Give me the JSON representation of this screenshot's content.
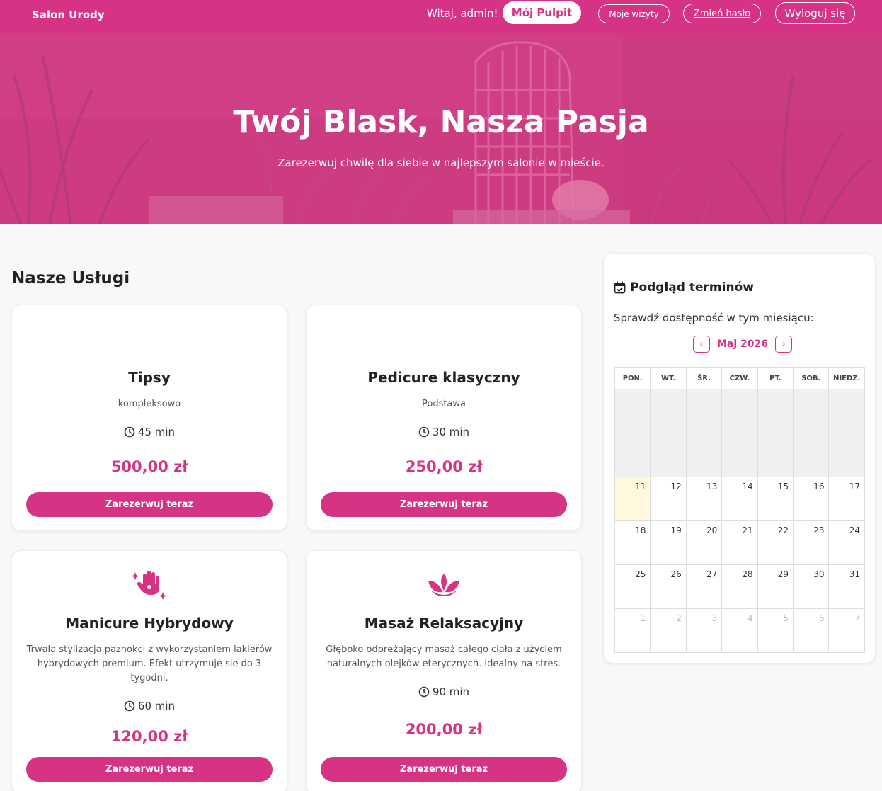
{
  "navbar": {
    "brand": "Salon Urody",
    "welcome": "Witaj, admin!",
    "dashboard": "Mój Pulpit",
    "my_visits": "Moje wizyty",
    "change_password": "Zmień hasło",
    "logout": "Wyloguj się"
  },
  "hero": {
    "title": "Twój Blask, Nasza Pasja",
    "subtitle": "Zarezerwuj chwilę dla siebie w najlepszym salonie w mieście."
  },
  "services": {
    "title": "Nasze Usługi",
    "book_label": "Zarezerwuj teraz",
    "items": [
      {
        "name": "Tipsy",
        "description": "kompleksowo",
        "duration": "45 min",
        "price": "500,00 zł",
        "icon": "none"
      },
      {
        "name": "Pedicure klasyczny",
        "description": "Podstawa",
        "duration": "30 min",
        "price": "250,00 zł",
        "icon": "none"
      },
      {
        "name": "Manicure Hybrydowy",
        "description": "Trwała stylizacja paznokci z wykorzystaniem lakierów hybrydowych premium. Efekt utrzymuje się do 3 tygodni.",
        "duration": "60 min",
        "price": "120,00 zł",
        "icon": "sparkle-hand-icon"
      },
      {
        "name": "Masaż Relaksacyjny",
        "description": "Głęboko odprężający masaż całego ciała z użyciem naturalnych olejków eterycznych. Idealny na stres.",
        "duration": "90 min",
        "price": "200,00 zł",
        "icon": "lotus-icon"
      }
    ]
  },
  "calendar": {
    "title": "Podgląd terminów",
    "subtitle": "Sprawdź dostępność w tym miesiącu:",
    "month": "Maj 2026",
    "weekdays": [
      "PON.",
      "WT.",
      "ŚR.",
      "CZW.",
      "PT.",
      "SOB.",
      "NIEDZ."
    ],
    "weeks": [
      [
        "",
        "",
        "",
        "",
        "",
        "",
        ""
      ],
      [
        "",
        "",
        "",
        "",
        "",
        "",
        ""
      ],
      [
        "11",
        "12",
        "13",
        "14",
        "15",
        "16",
        "17"
      ],
      [
        "18",
        "19",
        "20",
        "21",
        "22",
        "23",
        "24"
      ],
      [
        "25",
        "26",
        "27",
        "28",
        "29",
        "30",
        "31"
      ],
      [
        "1",
        "2",
        "3",
        "4",
        "5",
        "6",
        "7"
      ]
    ],
    "today": "11"
  },
  "colors": {
    "accent": "#d63384",
    "today_bg": "#fff8dc",
    "past_bg": "#f0f0f0"
  }
}
